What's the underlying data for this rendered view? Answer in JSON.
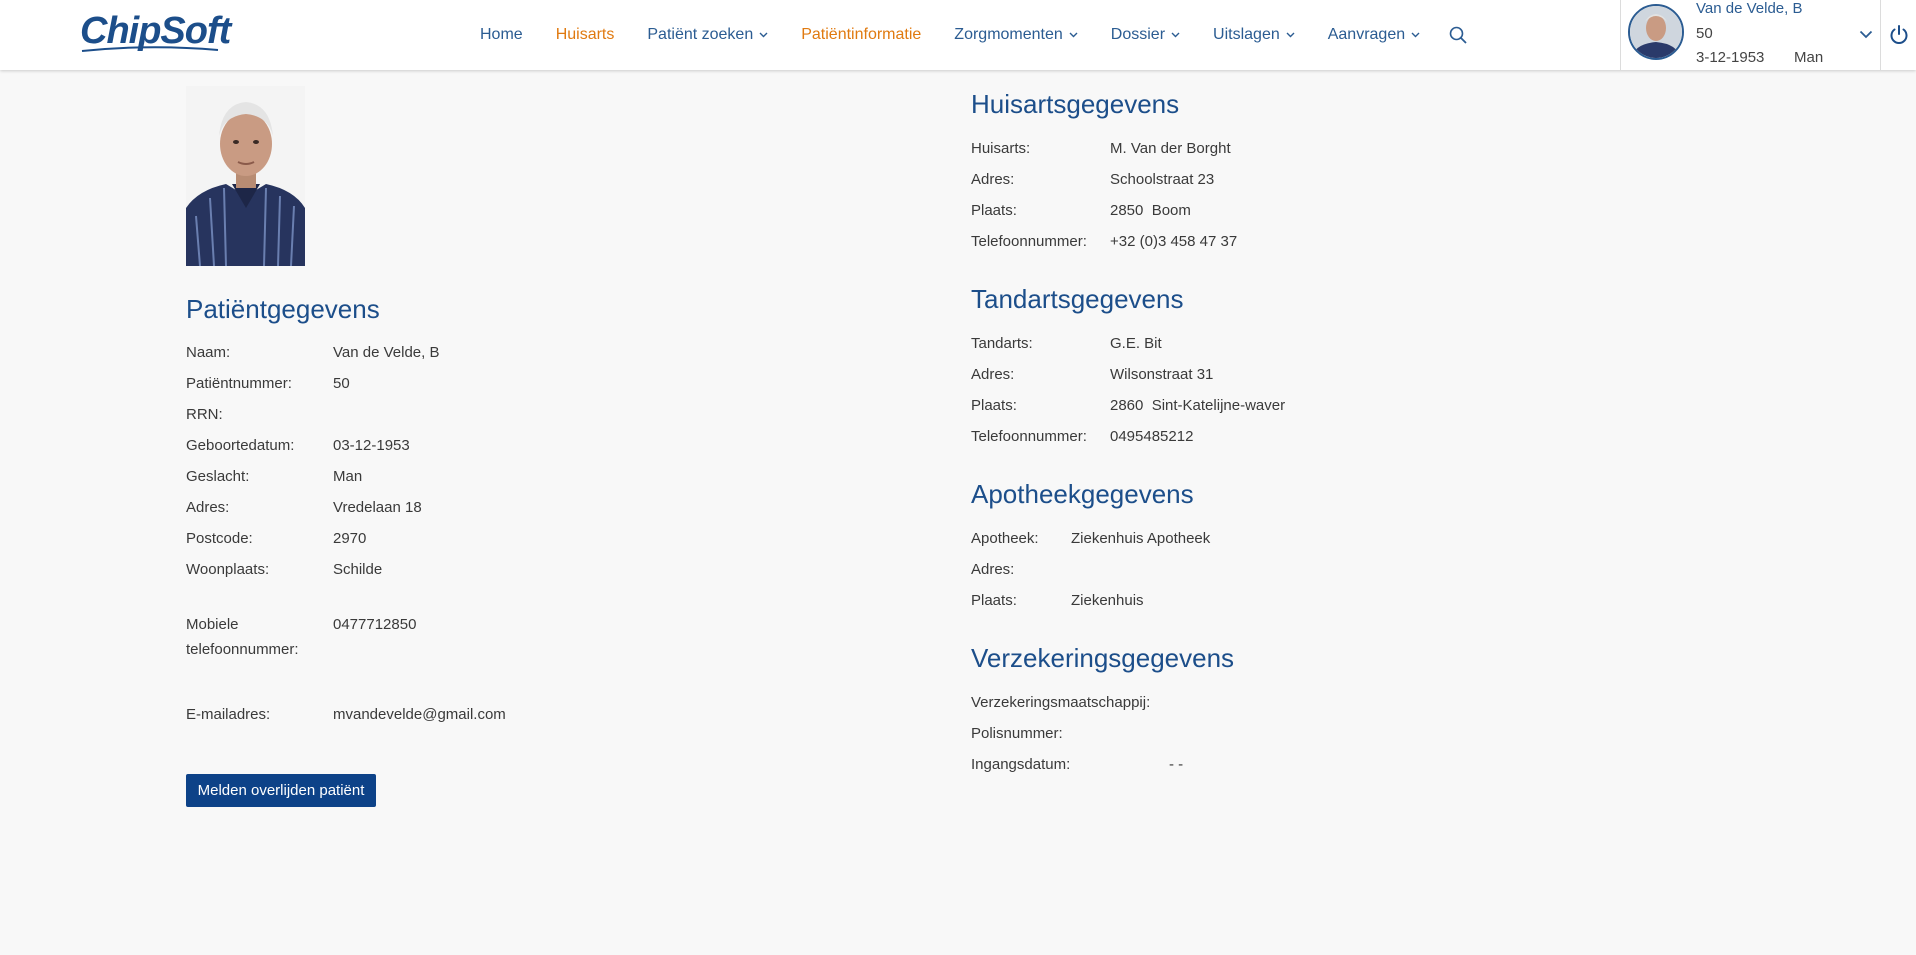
{
  "app": {
    "logo_text": "ChipSoft"
  },
  "nav": {
    "items": [
      {
        "label": "Home",
        "active": false,
        "dropdown": false
      },
      {
        "label": "Huisarts",
        "active": true,
        "dropdown": false
      },
      {
        "label": "Patiënt zoeken",
        "active": false,
        "dropdown": true
      },
      {
        "label": "Patiëntinformatie",
        "active": true,
        "dropdown": false
      },
      {
        "label": "Zorgmomenten",
        "active": false,
        "dropdown": true
      },
      {
        "label": "Dossier",
        "active": false,
        "dropdown": true
      },
      {
        "label": "Uitslagen",
        "active": false,
        "dropdown": true
      },
      {
        "label": "Aanvragen",
        "active": false,
        "dropdown": true
      }
    ],
    "search_icon": "search-icon"
  },
  "patient_header": {
    "name": "Van de Velde, B",
    "number": "50",
    "dob": "3-12-1953",
    "sex": "Man"
  },
  "patient": {
    "title": "Patiëntgegevens",
    "fields": [
      {
        "label": "Naam:",
        "value": "Van de Velde, B"
      },
      {
        "label": "Patiëntnummer:",
        "value": "50"
      },
      {
        "label": "RRN:",
        "value": ""
      },
      {
        "label": "Geboortedatum:",
        "value": "03-12-1953"
      },
      {
        "label": "Geslacht:",
        "value": "Man"
      },
      {
        "label": "Adres:",
        "value": "Vredelaan 18"
      },
      {
        "label": "Postcode:",
        "value": "2970"
      },
      {
        "label": "Woonplaats:",
        "value": "Schilde"
      },
      {
        "label": "Mobiele telefoonnummer:",
        "value": "0477712850"
      },
      {
        "label": "E-mailadres:",
        "value": "mvandevelde@gmail.com"
      }
    ],
    "mobile_label_line1": "Mobiele",
    "mobile_label_line2": "telefoonnummer:"
  },
  "huisarts": {
    "title": "Huisartsgegevens",
    "fields": [
      {
        "label": "Huisarts:",
        "value": "M. Van der Borght"
      },
      {
        "label": "Adres:",
        "value": "Schoolstraat 23"
      },
      {
        "label": "Plaats:",
        "value": "2850  Boom"
      },
      {
        "label": "Telefoonnummer:",
        "value": "+32 (0)3 458 47 37"
      }
    ]
  },
  "tandarts": {
    "title": "Tandartsgegevens",
    "fields": [
      {
        "label": "Tandarts:",
        "value": "G.E. Bit"
      },
      {
        "label": "Adres:",
        "value": "Wilsonstraat 31"
      },
      {
        "label": "Plaats:",
        "value": "2860  Sint-Katelijne-waver"
      },
      {
        "label": "Telefoonnummer:",
        "value": "0495485212"
      }
    ]
  },
  "apotheek": {
    "title": "Apotheekgegevens",
    "fields": [
      {
        "label": "Apotheek:",
        "value": "Ziekenhuis Apotheek"
      },
      {
        "label": "Adres:",
        "value": ""
      },
      {
        "label": "Plaats:",
        "value": "Ziekenhuis"
      }
    ]
  },
  "verzekering": {
    "title": "Verzekeringsgegevens",
    "fields": [
      {
        "label": "Verzekeringsmaatschappij:",
        "value": ""
      },
      {
        "label": "Polisnummer:",
        "value": ""
      },
      {
        "label": "Ingangsdatum:",
        "value": "- -"
      }
    ]
  },
  "actions": {
    "report_death_label": "Melden overlijden patiënt"
  },
  "colors": {
    "brand_blue": "#1c4e8a",
    "nav_blue": "#2b5c92",
    "active_orange": "#e07a10",
    "button_blue": "#0d4288"
  }
}
